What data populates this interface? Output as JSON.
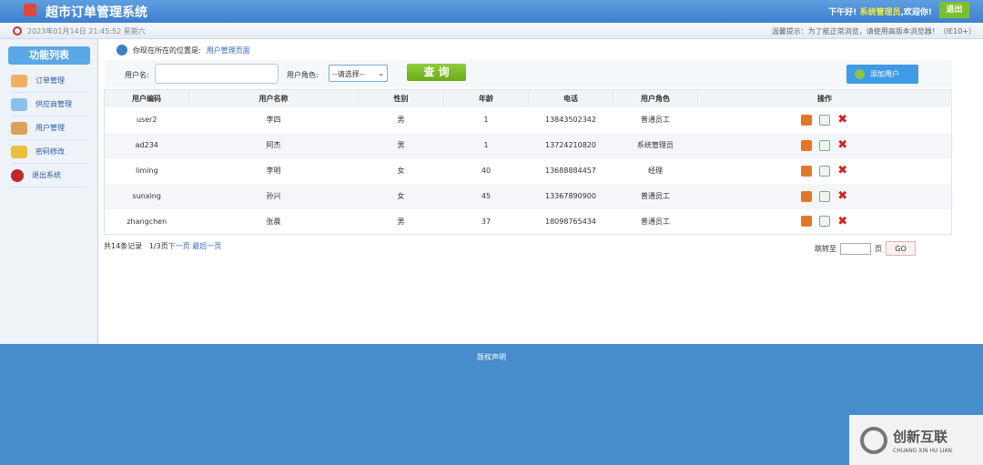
{
  "header": {
    "title": "超市订单管理系统",
    "greeting": "下午好!",
    "user": "系统管理员",
    "welcome": ",欢迎你!",
    "logout": "退出"
  },
  "subbar": {
    "time": "2023年01月14日 21:45:52 星期六",
    "tip": "温馨提示：为了能正常浏览，请使用高版本浏览器！（IE10+）"
  },
  "sidebar": {
    "title": "功能列表",
    "items": [
      {
        "label": "订单管理"
      },
      {
        "label": "供应商管理"
      },
      {
        "label": "用户管理"
      },
      {
        "label": "密码修改"
      },
      {
        "label": "退出系统"
      }
    ]
  },
  "breadcrumb": {
    "prefix": "你现在所在的位置是:",
    "current": "用户管理页面"
  },
  "search": {
    "name_label": "用户名:",
    "name_value": "",
    "role_label": "用户角色:",
    "role_selected": "--请选择--",
    "query": "查 询",
    "add": "添加用户"
  },
  "table": {
    "headers": [
      "用户编码",
      "用户名称",
      "性别",
      "年龄",
      "电话",
      "用户角色",
      "操作"
    ],
    "rows": [
      [
        "user2",
        "李四",
        "男",
        "1",
        "13843502342",
        "普通员工"
      ],
      [
        "ad234",
        "阿杰",
        "男",
        "1",
        "13724210820",
        "系统管理员"
      ],
      [
        "liming",
        "李明",
        "女",
        "40",
        "13688884457",
        "经理"
      ],
      [
        "sunxing",
        "孙兴",
        "女",
        "45",
        "13367890900",
        "普通员工"
      ],
      [
        "zhangchen",
        "张晨",
        "男",
        "37",
        "18098765434",
        "普通员工"
      ]
    ]
  },
  "pagination": {
    "total": "共14条记录",
    "page": "1/3页",
    "next": "下一页",
    "last": "最后一页",
    "jump": "跳转至",
    "unit": "页",
    "go": "GO"
  },
  "footer": {
    "text": "版权声明"
  },
  "watermark": {
    "name": "创新互联",
    "pinyin": "CHUANG XIN HU LIAN"
  }
}
